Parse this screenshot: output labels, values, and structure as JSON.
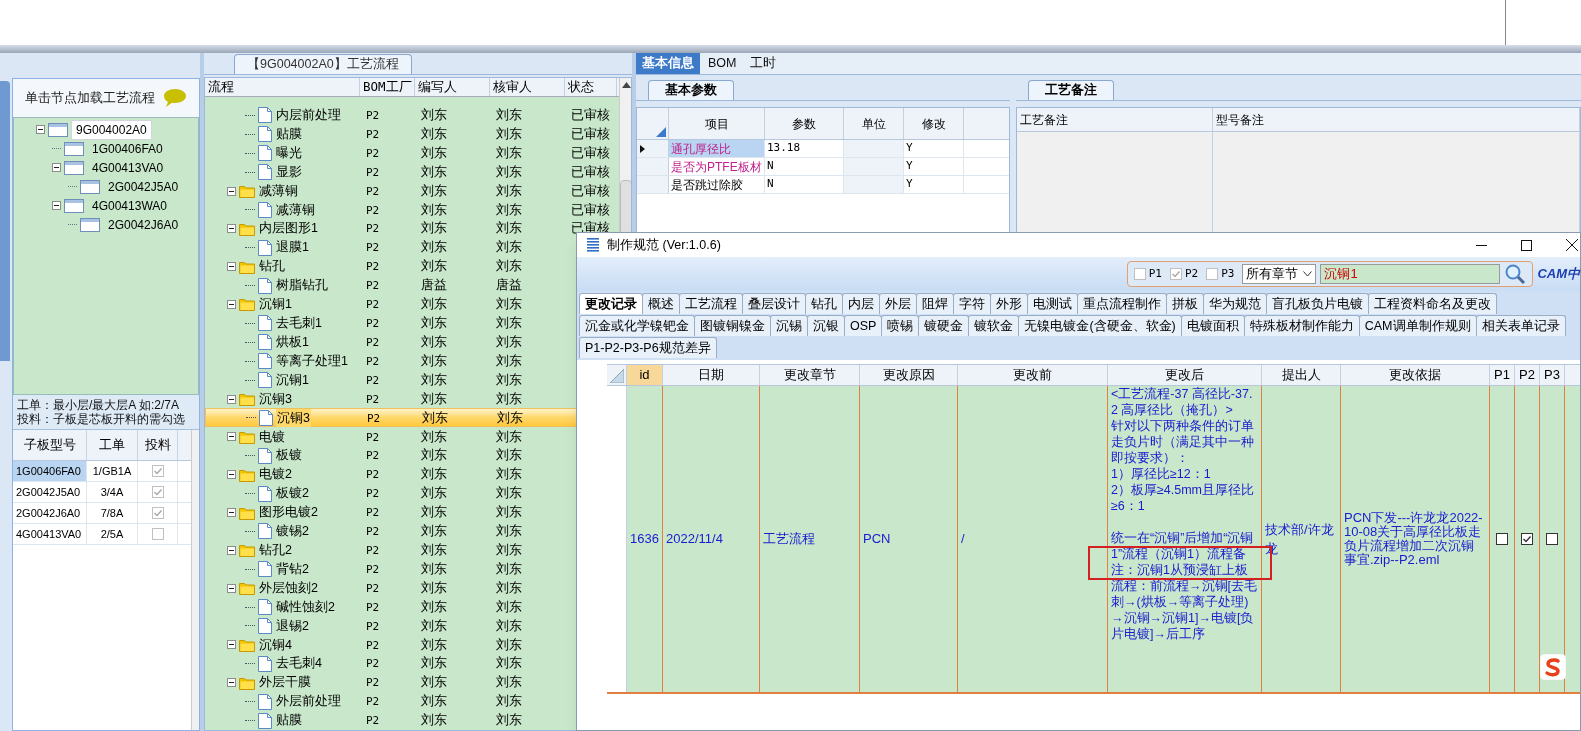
{
  "left_panel": {
    "header": "单击节点加载工艺流程",
    "tree": [
      {
        "label": "9G004002A0",
        "selected": true,
        "expanded": true,
        "children": [
          {
            "label": "1G00406FA0",
            "selected": false
          },
          {
            "label": "4G00413VA0",
            "selected": false,
            "expanded": true,
            "children": [
              {
                "label": "2G0042J5A0",
                "selected": false
              }
            ]
          },
          {
            "label": "4G00413WA0",
            "selected": false,
            "expanded": true,
            "children": [
              {
                "label": "2G0042J6A0",
                "selected": false
              }
            ]
          }
        ]
      }
    ],
    "note": [
      "工单：最小层/最大层A 如:2/7A",
      "投料：子板是芯板开料的需勾选"
    ],
    "table": {
      "columns": [
        "子板型号",
        "工单",
        "投料"
      ],
      "rows": [
        {
          "board": "1G00406FA0",
          "order": "1/GB1A",
          "feed": true,
          "selected": true
        },
        {
          "board": "2G0042J5A0",
          "order": "3/4A",
          "feed": true,
          "selected": false
        },
        {
          "board": "2G0042J6A0",
          "order": "7/8A",
          "feed": true,
          "selected": false
        },
        {
          "board": "4G00413VA0",
          "order": "2/5A",
          "feed": false,
          "selected": false
        }
      ]
    }
  },
  "flow_panel": {
    "title": "【9G004002A0】工艺流程",
    "columns": [
      "流程",
      "BOM工厂",
      "编写人",
      "核审人",
      "状态"
    ],
    "groups": [
      {
        "children": [
          {
            "name": "内层前处理",
            "bom": "P2",
            "writer": "刘东",
            "reviewer": "刘东",
            "status": "已审核",
            "selected": false
          },
          {
            "name": "贴膜",
            "bom": "P2",
            "writer": "刘东",
            "reviewer": "刘东",
            "status": "已审核",
            "selected": false
          },
          {
            "name": "曝光",
            "bom": "P2",
            "writer": "刘东",
            "reviewer": "刘东",
            "status": "已审核",
            "selected": false
          },
          {
            "name": "显影",
            "bom": "P2",
            "writer": "刘东",
            "reviewer": "刘东",
            "status": "已审核",
            "selected": false
          }
        ]
      },
      {
        "name": "减薄铜",
        "bom": "P2",
        "writer": "刘东",
        "reviewer": "刘东",
        "status": "已审核",
        "expanded": true,
        "selected": false,
        "children": [
          {
            "name": "减薄铜",
            "bom": "P2",
            "writer": "刘东",
            "reviewer": "刘东",
            "status": "已审核",
            "selected": false
          }
        ]
      },
      {
        "name": "内层图形1",
        "bom": "P2",
        "writer": "刘东",
        "reviewer": "刘东",
        "status": "已审核",
        "expanded": true,
        "selected": false,
        "children": [
          {
            "name": "退膜1",
            "bom": "P2",
            "writer": "刘东",
            "reviewer": "刘东",
            "selected": false
          }
        ]
      },
      {
        "name": "钻孔",
        "bom": "P2",
        "writer": "刘东",
        "reviewer": "刘东",
        "expanded": true,
        "selected": false,
        "children": [
          {
            "name": "树脂钻孔",
            "bom": "P2",
            "writer": "唐益",
            "reviewer": "唐益",
            "selected": false
          }
        ]
      },
      {
        "name": "沉铜1",
        "bom": "P2",
        "writer": "刘东",
        "reviewer": "刘东",
        "expanded": true,
        "selected": false,
        "children": [
          {
            "name": "去毛刺1",
            "bom": "P2",
            "writer": "刘东",
            "reviewer": "刘东",
            "selected": false
          },
          {
            "name": "烘板1",
            "bom": "P2",
            "writer": "刘东",
            "reviewer": "刘东",
            "selected": false
          },
          {
            "name": "等离子处理1",
            "bom": "P2",
            "writer": "刘东",
            "reviewer": "刘东",
            "selected": false
          },
          {
            "name": "沉铜1",
            "bom": "P2",
            "writer": "刘东",
            "reviewer": "刘东",
            "selected": false
          }
        ]
      },
      {
        "name": "沉铜3",
        "bom": "P2",
        "writer": "刘东",
        "reviewer": "刘东",
        "expanded": true,
        "selected": false,
        "children": [
          {
            "name": "沉铜3",
            "bom": "P2",
            "writer": "刘东",
            "reviewer": "刘东",
            "selected": true
          }
        ]
      },
      {
        "name": "电镀",
        "bom": "P2",
        "writer": "刘东",
        "reviewer": "刘东",
        "expanded": true,
        "selected": false,
        "children": [
          {
            "name": "板镀",
            "bom": "P2",
            "writer": "刘东",
            "reviewer": "刘东",
            "selected": false
          }
        ]
      },
      {
        "name": "电镀2",
        "bom": "P2",
        "writer": "刘东",
        "reviewer": "刘东",
        "expanded": true,
        "selected": false,
        "children": [
          {
            "name": "板镀2",
            "bom": "P2",
            "writer": "刘东",
            "reviewer": "刘东",
            "selected": false
          }
        ]
      },
      {
        "name": "图形电镀2",
        "bom": "P2",
        "writer": "刘东",
        "reviewer": "刘东",
        "expanded": true,
        "selected": false,
        "children": [
          {
            "name": "镀锡2",
            "bom": "P2",
            "writer": "刘东",
            "reviewer": "刘东",
            "selected": false
          }
        ]
      },
      {
        "name": "钻孔2",
        "bom": "P2",
        "writer": "刘东",
        "reviewer": "刘东",
        "expanded": true,
        "selected": false,
        "children": [
          {
            "name": "背钻2",
            "bom": "P2",
            "writer": "刘东",
            "reviewer": "刘东",
            "selected": false
          }
        ]
      },
      {
        "name": "外层蚀刻2",
        "bom": "P2",
        "writer": "刘东",
        "reviewer": "刘东",
        "expanded": true,
        "selected": false,
        "children": [
          {
            "name": "碱性蚀刻2",
            "bom": "P2",
            "writer": "刘东",
            "reviewer": "刘东",
            "selected": false
          },
          {
            "name": "退锡2",
            "bom": "P2",
            "writer": "刘东",
            "reviewer": "刘东",
            "selected": false
          }
        ]
      },
      {
        "name": "沉铜4",
        "bom": "P2",
        "writer": "刘东",
        "reviewer": "刘东",
        "expanded": true,
        "selected": false,
        "children": [
          {
            "name": "去毛刺4",
            "bom": "P2",
            "writer": "刘东",
            "reviewer": "刘东",
            "selected": false
          }
        ]
      },
      {
        "name": "外层干膜",
        "bom": "P2",
        "writer": "刘东",
        "reviewer": "刘东",
        "expanded": true,
        "selected": false,
        "children": [
          {
            "name": "外层前处理",
            "bom": "P2",
            "writer": "刘东",
            "reviewer": "刘东",
            "selected": false
          },
          {
            "name": "贴膜",
            "bom": "P2",
            "writer": "刘东",
            "reviewer": "刘东",
            "selected": false
          }
        ]
      }
    ]
  },
  "info_panel": {
    "tabs": [
      {
        "label": "基本信息",
        "selected": true
      },
      {
        "label": "BOM",
        "selected": false
      },
      {
        "label": "工时",
        "selected": false
      }
    ],
    "params": {
      "tab": "基本参数",
      "columns": [
        "项目",
        "参数",
        "单位",
        "修改"
      ],
      "rows": [
        {
          "item": "通孔厚径比",
          "value": "13.18",
          "modify": "Y",
          "highlighted": true,
          "selected": true
        },
        {
          "item": "是否为PTFE板材",
          "value": "N",
          "modify": "Y",
          "highlighted": true,
          "selected": false
        },
        {
          "item": "是否跳过除胶",
          "value": "N",
          "modify": "Y",
          "highlighted": false,
          "selected": false
        }
      ]
    },
    "notes": {
      "tab": "工艺备注",
      "columns": [
        "工艺备注",
        "型号备注"
      ]
    }
  },
  "dialog": {
    "title": "制作规范 (Ver:1.0.6)",
    "filters": [
      {
        "label": "P1",
        "checked": false
      },
      {
        "label": "P2",
        "checked": true
      },
      {
        "label": "P3",
        "checked": false
      }
    ],
    "chapter": "所有章节",
    "search": "沉铜1",
    "logo": "CAM中",
    "tab_rows": [
      [
        {
          "label": "更改记录",
          "selected": true
        },
        {
          "label": "概述",
          "selected": false
        },
        {
          "label": "工艺流程",
          "selected": false
        },
        {
          "label": "叠层设计",
          "selected": false
        },
        {
          "label": "钻孔",
          "selected": false
        },
        {
          "label": "内层",
          "selected": false
        },
        {
          "label": "外层",
          "selected": false
        },
        {
          "label": "阻焊",
          "selected": false
        },
        {
          "label": "字符",
          "selected": false
        },
        {
          "label": "外形",
          "selected": false
        },
        {
          "label": "电测试",
          "selected": false
        },
        {
          "label": "重点流程制作",
          "selected": false
        },
        {
          "label": "拼板",
          "selected": false
        },
        {
          "label": "华为规范",
          "selected": false
        },
        {
          "label": "盲孔板负片电镀",
          "selected": false
        },
        {
          "label": "工程资料命名及更改",
          "selected": false
        }
      ],
      [
        {
          "label": "沉金或化学镍钯金",
          "selected": false
        },
        {
          "label": "图镀铜镍金",
          "selected": false
        },
        {
          "label": "沉锡",
          "selected": false
        },
        {
          "label": "沉银",
          "selected": false
        },
        {
          "label": "OSP",
          "selected": false
        },
        {
          "label": "喷锡",
          "selected": false
        },
        {
          "label": "镀硬金",
          "selected": false
        },
        {
          "label": "镀软金",
          "selected": false
        },
        {
          "label": "无镍电镀金(含硬金、软金)",
          "selected": false
        },
        {
          "label": "电镀面积",
          "selected": false
        },
        {
          "label": "特殊板材制作能力",
          "selected": false
        },
        {
          "label": "CAM调单制作规则",
          "selected": false
        },
        {
          "label": "相关表单记录",
          "selected": false
        }
      ],
      [
        {
          "label": "P1-P2-P3-P6规范差异",
          "selected": false
        }
      ]
    ],
    "table": {
      "columns": [
        "id",
        "日期",
        "更改章节",
        "更改原因",
        "更改前",
        "更改后",
        "提出人",
        "更改依据",
        "P1",
        "P2",
        "P3"
      ],
      "rows": [
        {
          "id": "1636",
          "date": "2022/11/4",
          "chapter": "工艺流程",
          "reason": "PCN",
          "before": "/",
          "after": "<工艺流程-37 高径比-37.2 高厚径比（掩孔）>\n针对以下两种条件的订单走负片时（满足其中一种即按要求）：\n1）厚径比≥12：1\n2）板厚≥4.5mm且厚径比≥6：1\n\n统一在“沉铜”后增加“沉铜1”流程（沉铜1）流程备注：沉铜1从预浸缸上板流程：前流程→沉铜[去毛刺→(烘板→等离子处理)→沉铜→沉铜1]→电镀[负片电镀]→后工序",
          "proposer": "技术部/许龙龙",
          "basis": "PCN下发---许龙龙2022-10-08关于高厚径比板走负片流程增加二次沉铜事宜.zip--P2.eml",
          "p1": false,
          "p2": true,
          "p3": false
        }
      ]
    }
  }
}
